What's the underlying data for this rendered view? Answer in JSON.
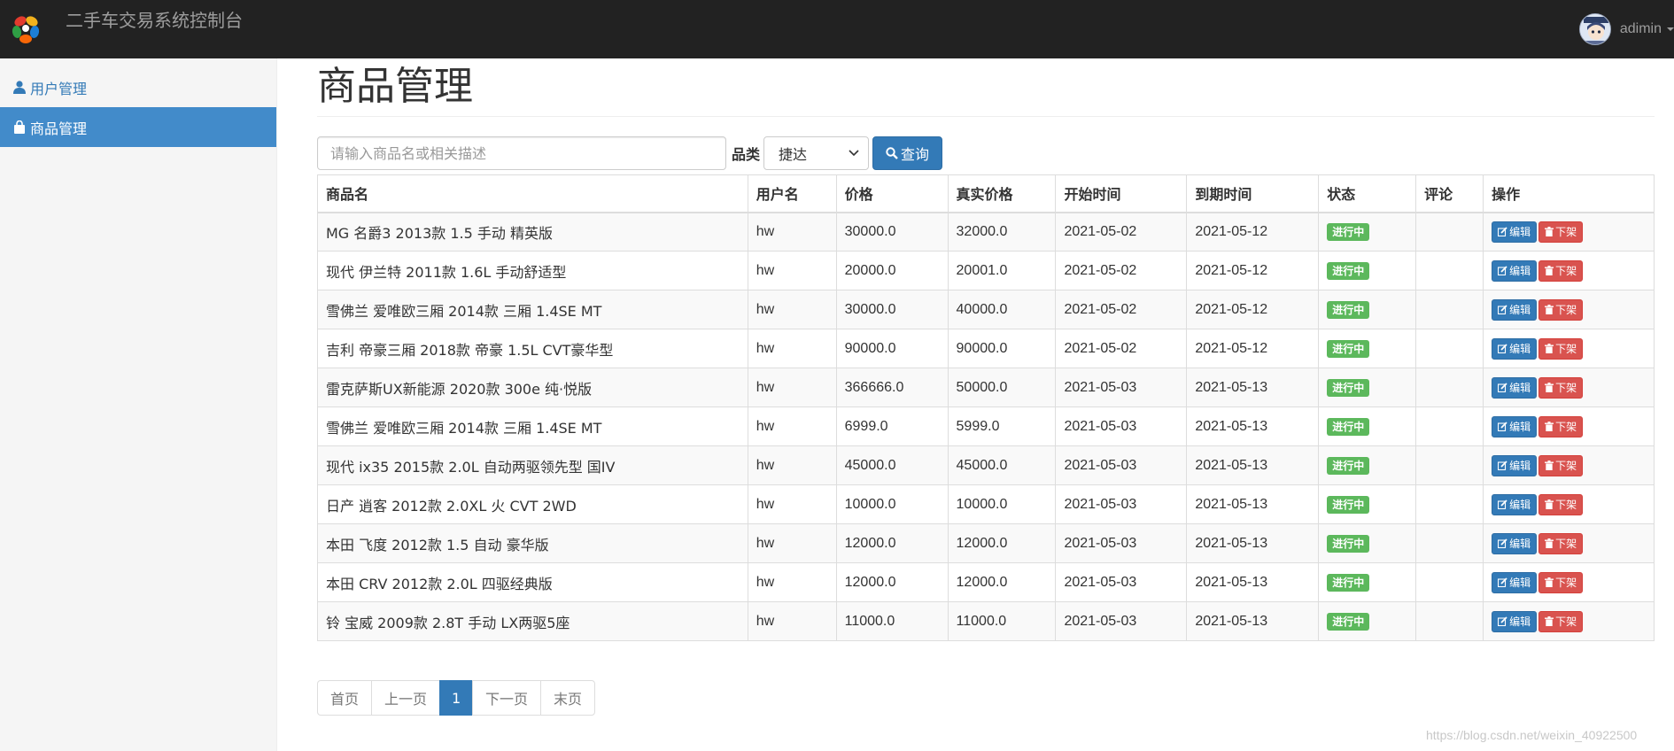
{
  "app": {
    "title": "二手车交易系统控制台"
  },
  "user": {
    "name": "adimin"
  },
  "sidebar": {
    "items": [
      {
        "label": "用户管理",
        "icon": "user-icon",
        "active": false
      },
      {
        "label": "商品管理",
        "icon": "shopping-bag-icon",
        "active": true
      }
    ]
  },
  "main": {
    "title": "商品管理",
    "search": {
      "placeholder": "请输入商品名或相关描述",
      "value": "",
      "category_label": "品类",
      "category_selected": "捷达",
      "query_button": "查询"
    },
    "table": {
      "columns": [
        "商品名",
        "用户名",
        "价格",
        "真实价格",
        "开始时间",
        "到期时间",
        "状态",
        "评论",
        "操作"
      ],
      "rows": [
        {
          "name": "MG 名爵3 2013款 1.5 手动 精英版",
          "user": "hw",
          "price": "30000.0",
          "real_price": "32000.0",
          "start": "2021-05-02",
          "end": "2021-05-12",
          "status": "进行中",
          "comment": ""
        },
        {
          "name": "现代 伊兰特 2011款 1.6L 手动舒适型",
          "user": "hw",
          "price": "20000.0",
          "real_price": "20001.0",
          "start": "2021-05-02",
          "end": "2021-05-12",
          "status": "进行中",
          "comment": ""
        },
        {
          "name": "雪佛兰 爱唯欧三厢 2014款 三厢 1.4SE MT",
          "user": "hw",
          "price": "30000.0",
          "real_price": "40000.0",
          "start": "2021-05-02",
          "end": "2021-05-12",
          "status": "进行中",
          "comment": ""
        },
        {
          "name": "吉利 帝豪三厢 2018款 帝豪 1.5L CVT豪华型",
          "user": "hw",
          "price": "90000.0",
          "real_price": "90000.0",
          "start": "2021-05-02",
          "end": "2021-05-12",
          "status": "进行中",
          "comment": ""
        },
        {
          "name": "雷克萨斯UX新能源 2020款 300e 纯·悦版",
          "user": "hw",
          "price": "366666.0",
          "real_price": "50000.0",
          "start": "2021-05-03",
          "end": "2021-05-13",
          "status": "进行中",
          "comment": ""
        },
        {
          "name": "雪佛兰 爱唯欧三厢 2014款 三厢 1.4SE MT",
          "user": "hw",
          "price": "6999.0",
          "real_price": "5999.0",
          "start": "2021-05-03",
          "end": "2021-05-13",
          "status": "进行中",
          "comment": ""
        },
        {
          "name": "现代 ix35 2015款 2.0L 自动两驱领先型 国IV",
          "user": "hw",
          "price": "45000.0",
          "real_price": "45000.0",
          "start": "2021-05-03",
          "end": "2021-05-13",
          "status": "进行中",
          "comment": ""
        },
        {
          "name": "日产 逍客 2012款 2.0XL 火 CVT 2WD",
          "user": "hw",
          "price": "10000.0",
          "real_price": "10000.0",
          "start": "2021-05-03",
          "end": "2021-05-13",
          "status": "进行中",
          "comment": ""
        },
        {
          "name": "本田 飞度 2012款 1.5 自动 豪华版",
          "user": "hw",
          "price": "12000.0",
          "real_price": "12000.0",
          "start": "2021-05-03",
          "end": "2021-05-13",
          "status": "进行中",
          "comment": ""
        },
        {
          "name": "本田 CRV 2012款 2.0L 四驱经典版",
          "user": "hw",
          "price": "12000.0",
          "real_price": "12000.0",
          "start": "2021-05-03",
          "end": "2021-05-13",
          "status": "进行中",
          "comment": ""
        },
        {
          "name": "铃 宝威 2009款 2.8T 手动 LX两驱5座",
          "user": "hw",
          "price": "11000.0",
          "real_price": "11000.0",
          "start": "2021-05-03",
          "end": "2021-05-13",
          "status": "进行中",
          "comment": ""
        }
      ],
      "actions": {
        "edit": "编辑",
        "off": "下架"
      }
    },
    "pagination": {
      "first": "首页",
      "prev": "上一页",
      "current": "1",
      "next": "下一页",
      "last": "末页"
    }
  },
  "watermark": "https://blog.csdn.net/weixin_40922500",
  "colors": {
    "navbar": "#222222",
    "primary": "#337ab7",
    "sidebar_active": "#428bca",
    "success": "#5cb85c",
    "danger": "#d9534f"
  }
}
